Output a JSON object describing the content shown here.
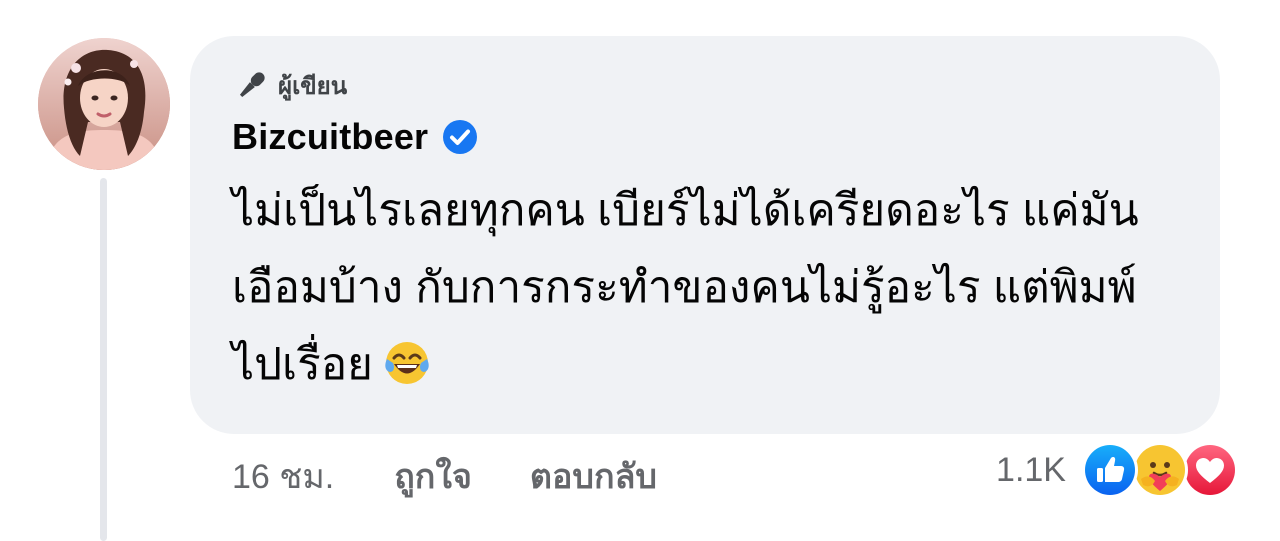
{
  "comment": {
    "author_tag": "ผู้เขียน",
    "author_name": "Bizcuitbeer",
    "verified": true,
    "text_lines": [
      "ไม่เป็นไรเลยทุกคน เบียร์ไม่ได้เครียดอะไร แค่มัน",
      "เอือมบ้าง กับการกระทำของคนไม่รู้อะไร แต่พิมพ์",
      "ไปเรื่อย"
    ],
    "emoji": "face-with-tears-of-joy-icon"
  },
  "actions": {
    "timestamp": "16 ชม.",
    "like_label": "ถูกใจ",
    "reply_label": "ตอบกลับ"
  },
  "reactions": {
    "count": "1.1K",
    "types": [
      "like-reaction-icon",
      "care-reaction-icon",
      "love-reaction-icon"
    ]
  },
  "colors": {
    "bubble_bg": "#f0f2f5",
    "secondary_text": "#65676b",
    "verified_blue": "#1877f2",
    "love_red": "#f33e58",
    "thread_line": "#e4e6eb"
  }
}
